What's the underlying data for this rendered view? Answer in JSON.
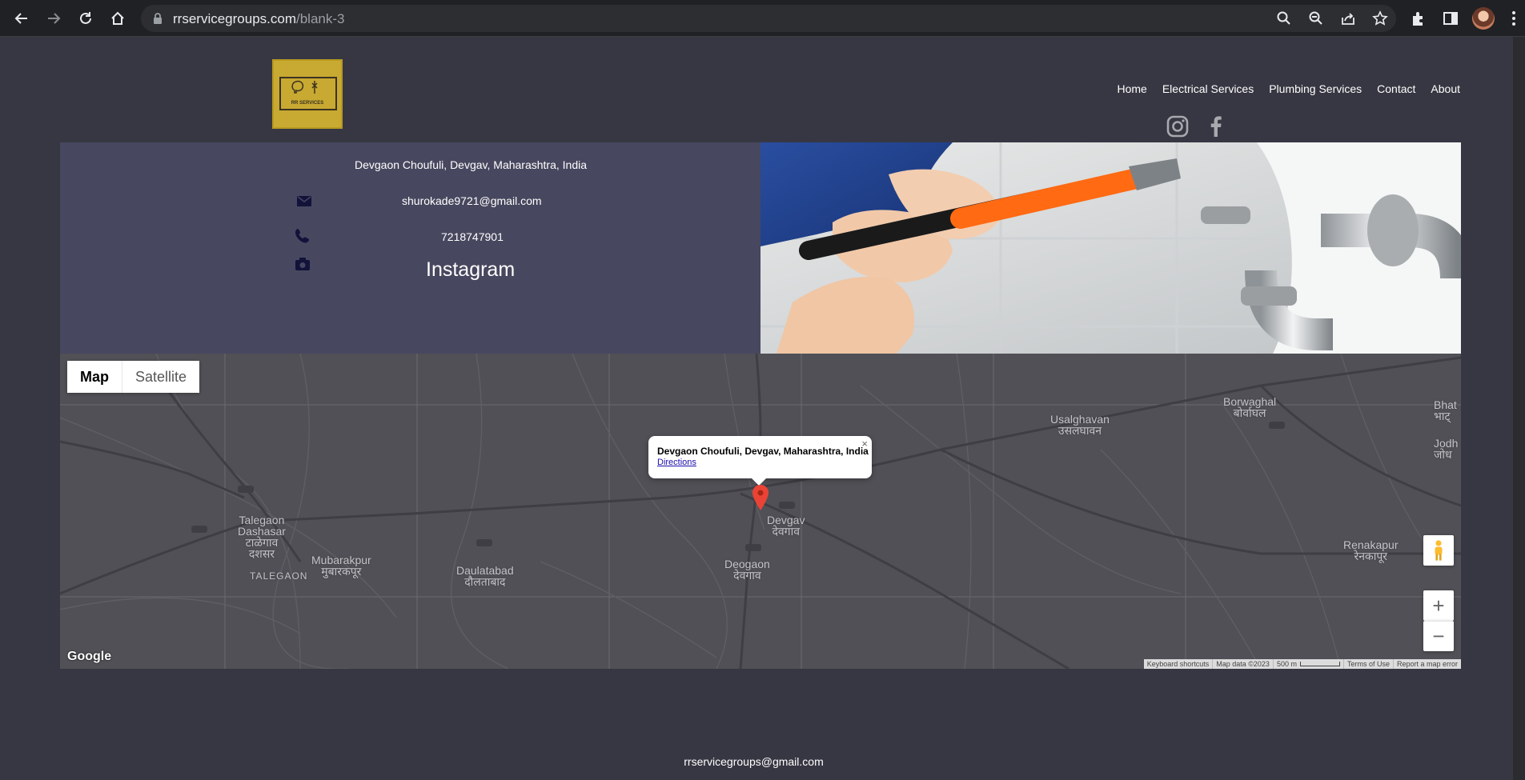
{
  "browser": {
    "url_domain": "rrservicegroups.com",
    "url_path": "/blank-3"
  },
  "site": {
    "logo_text": "RR SERVICES",
    "menu": [
      "Home",
      "Electrical Services",
      "Plumbing Services",
      "Contact",
      "About"
    ]
  },
  "contact": {
    "address": "Devgaon Choufuli, Devgav, Maharashtra, India",
    "email": "shurokade9721@gmail.com",
    "phone": "7218747901",
    "instagram": "Instagram"
  },
  "map": {
    "type_map": "Map",
    "type_satellite": "Satellite",
    "places": [
      {
        "name": "Talegaon\nDashasar\nटाळेगाव\nदशसर"
      },
      {
        "name": "TALEGAON"
      },
      {
        "name": "Mubarakpur\nमुबारकपूर"
      },
      {
        "name": "Daulatabad\nदौलताबाद"
      },
      {
        "name": "Devgav\nदेवगाव"
      },
      {
        "name": "Deogaon\nदेवगाव"
      },
      {
        "name": "Usalghavan\nउसलघावन"
      },
      {
        "name": "Borwaghal\nबोर्वाघल"
      },
      {
        "name": "Renakapur\nरेनकापूर"
      },
      {
        "name": "Bhat\nभाट्"
      },
      {
        "name": "Jodh\nजोध"
      }
    ],
    "info_title": "Devgaon Choufuli, Devgav, Maharashtra, India",
    "info_link": "Directions",
    "info_close": "×",
    "zoom_in": "+",
    "zoom_out": "−",
    "google": "Google",
    "footer": [
      "Keyboard shortcuts",
      "Map data ©2023",
      "500 m",
      "Terms of Use",
      "Report a map error"
    ]
  },
  "footer_email": "rrservicegroups@gmail.com"
}
